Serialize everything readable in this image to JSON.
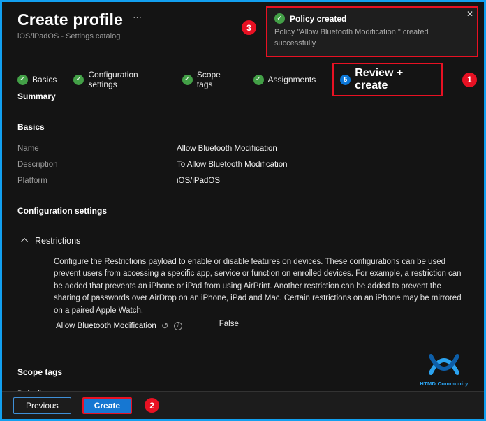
{
  "colors": {
    "accent_blue": "#1677d2",
    "success_green": "#43a047",
    "annotation_red": "#e81123",
    "page_border_blue": "#12a0f0"
  },
  "header": {
    "title": "Create profile",
    "menu_ellipsis": "···",
    "subtitle": "iOS/iPadOS - Settings catalog"
  },
  "toast": {
    "check_icon": "✓",
    "title": "Policy created",
    "message": "Policy \"Allow Bluetooth Modification \" created successfully",
    "close_icon": "✕"
  },
  "annotations": {
    "one": "1",
    "two": "2",
    "three": "3"
  },
  "wizard": {
    "steps": [
      {
        "label": "Basics",
        "icon": "✓"
      },
      {
        "label": "Configuration settings",
        "icon": "✓"
      },
      {
        "label": "Scope tags",
        "icon": "✓"
      },
      {
        "label": "Assignments",
        "icon": "✓"
      },
      {
        "label": "Review + create",
        "number": "5"
      }
    ]
  },
  "summary": {
    "heading": "Summary",
    "basics_heading": "Basics",
    "rows": [
      {
        "label": "Name",
        "value": "Allow Bluetooth Modification"
      },
      {
        "label": "Description",
        "value": "To Allow Bluetooth Modification"
      },
      {
        "label": "Platform",
        "value": "iOS/iPadOS"
      }
    ],
    "config_heading": "Configuration settings",
    "restrictions": {
      "title": "Restrictions",
      "description": "Configure the Restrictions payload to enable or disable features on devices. These configurations can be used prevent users from accessing a specific app, service or function on enrolled devices. For example, a restriction can be added that prevents an iPhone or iPad from using AirPrint. Another restriction can be added to prevent the sharing of passwords over AirDrop on an iPhone, iPad and Mac. Certain restrictions on an iPhone may be mirrored on a paired Apple Watch.",
      "setting_label": "Allow Bluetooth Modification",
      "revert_icon": "↺",
      "info_icon": "i",
      "setting_value": "False"
    },
    "scope_heading": "Scope tags",
    "scope_value": "Default"
  },
  "footer": {
    "previous_label": "Previous",
    "create_label": "Create"
  },
  "logo": {
    "text": "HTMD Community"
  }
}
